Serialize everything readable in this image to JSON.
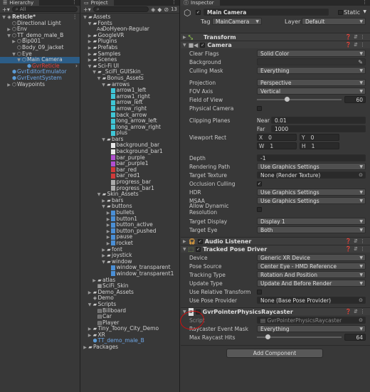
{
  "hierarchy": {
    "tab": "Hierarchy",
    "search_placeholder": "All",
    "items": [
      {
        "label": "Reticle*",
        "depth": 0,
        "arrow": "▼",
        "icon": "unity",
        "bold": true
      },
      {
        "label": "Directional Light",
        "depth": 1,
        "arrow": "",
        "icon": "cube"
      },
      {
        "label": "Env",
        "depth": 1,
        "arrow": "▶",
        "icon": "cube"
      },
      {
        "label": "TT_demo_male_B",
        "depth": 1,
        "arrow": "▼",
        "icon": "cube"
      },
      {
        "label": "Bip001",
        "depth": 2,
        "arrow": "▶",
        "icon": "cube"
      },
      {
        "label": "Body_09_jacket",
        "depth": 2,
        "arrow": "",
        "icon": "cube"
      },
      {
        "label": "Eye",
        "depth": 2,
        "arrow": "▼",
        "icon": "cube"
      },
      {
        "label": "Main Camera",
        "depth": 3,
        "arrow": "▼",
        "icon": "cube",
        "selected": true
      },
      {
        "label": "GvrReticle",
        "depth": 4,
        "arrow": "",
        "icon": "prefab-red",
        "red": true
      },
      {
        "label": "GvrEditorEmulator",
        "depth": 1,
        "arrow": "",
        "icon": "prefab"
      },
      {
        "label": "GvrEventSystem",
        "depth": 1,
        "arrow": "",
        "icon": "prefab"
      },
      {
        "label": "Waypoints",
        "depth": 1,
        "arrow": "▶",
        "icon": "cube"
      }
    ]
  },
  "project": {
    "tab": "Project",
    "count_label": "13",
    "items": [
      {
        "label": "Assets",
        "depth": 0,
        "arrow": "▼",
        "icon": "folder"
      },
      {
        "label": "Fonts",
        "depth": 1,
        "arrow": "▼",
        "icon": "folder"
      },
      {
        "label": "DoHyeon-Regular",
        "depth": 2,
        "arrow": "",
        "icon": "font"
      },
      {
        "label": "GoogleVR",
        "depth": 1,
        "arrow": "▶",
        "icon": "folder"
      },
      {
        "label": "Plugins",
        "depth": 1,
        "arrow": "▶",
        "icon": "folder"
      },
      {
        "label": "Prefabs",
        "depth": 1,
        "arrow": "▶",
        "icon": "folder"
      },
      {
        "label": "Samples",
        "depth": 1,
        "arrow": "▶",
        "icon": "folder"
      },
      {
        "label": "Scenes",
        "depth": 1,
        "arrow": "▶",
        "icon": "folder"
      },
      {
        "label": "Sci-Fi UI",
        "depth": 1,
        "arrow": "▼",
        "icon": "folder"
      },
      {
        "label": "_SciFi_GUISkin_",
        "depth": 2,
        "arrow": "▼",
        "icon": "folder"
      },
      {
        "label": "Bonus_Assets",
        "depth": 3,
        "arrow": "▼",
        "icon": "folder"
      },
      {
        "label": "arrows",
        "depth": 4,
        "arrow": "▼",
        "icon": "folder"
      },
      {
        "label": "arrow1_left",
        "depth": 5,
        "arrow": "",
        "icon": "sprite"
      },
      {
        "label": "arrow1_right",
        "depth": 5,
        "arrow": "",
        "icon": "sprite"
      },
      {
        "label": "arrow_left",
        "depth": 5,
        "arrow": "",
        "icon": "sprite"
      },
      {
        "label": "arrow_right",
        "depth": 5,
        "arrow": "",
        "icon": "sprite"
      },
      {
        "label": "back_arrow",
        "depth": 5,
        "arrow": "",
        "icon": "sprite"
      },
      {
        "label": "long_arrow_left",
        "depth": 5,
        "arrow": "",
        "icon": "sprite"
      },
      {
        "label": "long_arrow_right",
        "depth": 5,
        "arrow": "",
        "icon": "sprite"
      },
      {
        "label": "plus",
        "depth": 5,
        "arrow": "",
        "icon": "sprite"
      },
      {
        "label": "bars",
        "depth": 4,
        "arrow": "▼",
        "icon": "folder"
      },
      {
        "label": "background_bar",
        "depth": 5,
        "arrow": "",
        "icon": "sprite-white"
      },
      {
        "label": "background_bar1",
        "depth": 5,
        "arrow": "",
        "icon": "sprite-white"
      },
      {
        "label": "bar_purple",
        "depth": 5,
        "arrow": "",
        "icon": "sprite-purple"
      },
      {
        "label": "bar_purple1",
        "depth": 5,
        "arrow": "",
        "icon": "sprite-purple"
      },
      {
        "label": "bar_red",
        "depth": 5,
        "arrow": "",
        "icon": "sprite-red"
      },
      {
        "label": "bar_red1",
        "depth": 5,
        "arrow": "",
        "icon": "sprite-red"
      },
      {
        "label": "progress_bar",
        "depth": 5,
        "arrow": "",
        "icon": "sprite-line"
      },
      {
        "label": "progress_bar1",
        "depth": 5,
        "arrow": "",
        "icon": "sprite-line"
      },
      {
        "label": "Skin_Assets",
        "depth": 3,
        "arrow": "▼",
        "icon": "folder"
      },
      {
        "label": "bars",
        "depth": 4,
        "arrow": "▶",
        "icon": "folder"
      },
      {
        "label": "buttons",
        "depth": 4,
        "arrow": "▼",
        "icon": "folder"
      },
      {
        "label": "bullets",
        "depth": 5,
        "arrow": "▶",
        "icon": "sprite-blue"
      },
      {
        "label": "button1",
        "depth": 5,
        "arrow": "▶",
        "icon": "sprite-blue"
      },
      {
        "label": "button_active",
        "depth": 5,
        "arrow": "▶",
        "icon": "sprite-blue"
      },
      {
        "label": "button_pushed",
        "depth": 5,
        "arrow": "▶",
        "icon": "sprite-blue"
      },
      {
        "label": "pause",
        "depth": 5,
        "arrow": "▶",
        "icon": "sprite-blue"
      },
      {
        "label": "rocket",
        "depth": 5,
        "arrow": "▶",
        "icon": "sprite-blue"
      },
      {
        "label": "font",
        "depth": 4,
        "arrow": "▶",
        "icon": "folder"
      },
      {
        "label": "joystick",
        "depth": 4,
        "arrow": "▶",
        "icon": "folder"
      },
      {
        "label": "window",
        "depth": 4,
        "arrow": "▼",
        "icon": "folder"
      },
      {
        "label": "window_transparent",
        "depth": 5,
        "arrow": "",
        "icon": "sprite-blue"
      },
      {
        "label": "window_transparent1",
        "depth": 5,
        "arrow": "",
        "icon": "sprite-blue"
      },
      {
        "label": "atlas",
        "depth": 2,
        "arrow": "▶",
        "icon": "folder"
      },
      {
        "label": "SciFi_Skin",
        "depth": 2,
        "arrow": "",
        "icon": "skin"
      },
      {
        "label": "Demo_Assets",
        "depth": 1,
        "arrow": "▶",
        "icon": "folder"
      },
      {
        "label": "Demo",
        "depth": 1,
        "arrow": "",
        "icon": "unity"
      },
      {
        "label": "Scripts",
        "depth": 1,
        "arrow": "▼",
        "icon": "folder"
      },
      {
        "label": "Billboard",
        "depth": 2,
        "arrow": "",
        "icon": "script"
      },
      {
        "label": "Car",
        "depth": 2,
        "arrow": "",
        "icon": "script"
      },
      {
        "label": "Player",
        "depth": 2,
        "arrow": "",
        "icon": "script"
      },
      {
        "label": "Tiny_Toony_City_Demo",
        "depth": 1,
        "arrow": "▶",
        "icon": "folder"
      },
      {
        "label": "XR",
        "depth": 1,
        "arrow": "▶",
        "icon": "folder"
      },
      {
        "label": "TT_demo_male_B",
        "depth": 1,
        "arrow": "",
        "icon": "prefab"
      },
      {
        "label": "Packages",
        "depth": 0,
        "arrow": "▶",
        "icon": "folder"
      }
    ]
  },
  "inspector": {
    "tab": "Inspector",
    "object_name": "Main Camera",
    "static_label": "Static",
    "tag_label": "Tag",
    "tag_value": "MainCamera",
    "layer_label": "Layer",
    "layer_value": "Default",
    "transform_title": "Transform",
    "camera_title": "Camera",
    "camera": {
      "clear_flags": {
        "label": "Clear Flags",
        "value": "Solid Color"
      },
      "background": {
        "label": "Background"
      },
      "culling_mask": {
        "label": "Culling Mask",
        "value": "Everything"
      },
      "projection": {
        "label": "Projection",
        "value": "Perspective"
      },
      "fov_axis": {
        "label": "FOV Axis",
        "value": "Vertical"
      },
      "field_of_view": {
        "label": "Field of View",
        "value": "60",
        "fraction": 0.33
      },
      "physical_camera": {
        "label": "Physical Camera"
      },
      "clipping_planes": {
        "label": "Clipping Planes",
        "near_label": "Near",
        "near": "0.01",
        "far_label": "Far",
        "far": "1000"
      },
      "viewport_rect": {
        "label": "Viewport Rect",
        "x": "0",
        "y": "0",
        "w": "1",
        "h": "1"
      },
      "depth": {
        "label": "Depth",
        "value": "-1"
      },
      "rendering_path": {
        "label": "Rendering Path",
        "value": "Use Graphics Settings"
      },
      "target_texture": {
        "label": "Target Texture",
        "value": "None (Render Texture)"
      },
      "occlusion_culling": {
        "label": "Occlusion Culling"
      },
      "hdr": {
        "label": "HDR",
        "value": "Use Graphics Settings"
      },
      "msaa": {
        "label": "MSAA",
        "value": "Use Graphics Settings"
      },
      "allow_dynamic_resolution": {
        "label": "Allow Dynamic Resolution"
      },
      "target_display": {
        "label": "Target Display",
        "value": "Display 1"
      },
      "target_eye": {
        "label": "Target Eye",
        "value": "Both"
      }
    },
    "audio_listener_title": "Audio Listener",
    "tracked_pose_title": "Tracked Pose Driver",
    "tracked": {
      "device": {
        "label": "Device",
        "value": "Generic XR Device"
      },
      "pose_source": {
        "label": "Pose Source",
        "value": "Center Eye - HMD Reference"
      },
      "tracking_type": {
        "label": "Tracking Type",
        "value": "Rotation And Position"
      },
      "update_type": {
        "label": "Update Type",
        "value": "Update And Before Render"
      },
      "use_relative_transform": {
        "label": "Use Relative Transform"
      },
      "use_pose_provider": {
        "label": "Use Pose Provider",
        "value": "None (Base Pose Provider)"
      }
    },
    "raycaster_title": "GvrPointerPhysicsRaycaster",
    "raycaster": {
      "script": {
        "label": "Script",
        "value": "GvrPointerPhysicsRaycaster"
      },
      "event_mask": {
        "label": "Raycaster Event Mask",
        "value": "Everything"
      },
      "max_hits": {
        "label": "Max Raycast Hits",
        "value": "64",
        "fraction": 0.1
      }
    },
    "add_component": "Add Component"
  },
  "colors": {
    "selection": "#2c5d87",
    "annotation": "#d01010",
    "prefab_blue": "#5b9bd5"
  }
}
